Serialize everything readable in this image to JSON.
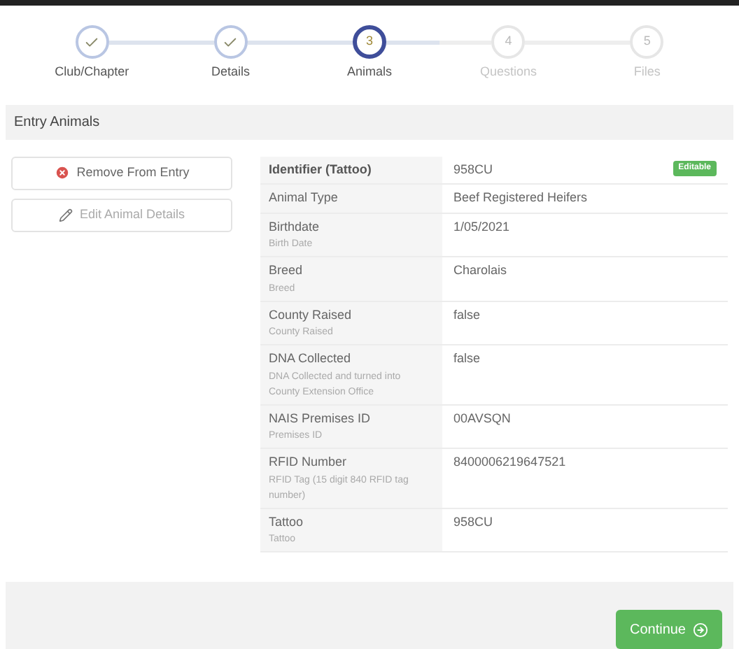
{
  "steps": [
    {
      "label": "Club/Chapter",
      "kind": "done"
    },
    {
      "label": "Details",
      "kind": "done"
    },
    {
      "label": "Animals",
      "kind": "current",
      "number": "3"
    },
    {
      "label": "Questions",
      "kind": "upcoming",
      "number": "4"
    },
    {
      "label": "Files",
      "kind": "upcoming",
      "number": "5"
    }
  ],
  "section_title": "Entry Animals",
  "actions": [
    {
      "label": "Remove From Entry",
      "kind": "remove"
    },
    {
      "label": "Edit Animal Details",
      "kind": "edit"
    }
  ],
  "details": [
    {
      "label": "Identifier (Tattoo)",
      "value": "958CU",
      "badge": "Editable",
      "kind": "key"
    },
    {
      "label": "Animal Type",
      "value": "Beef Registered Heifers",
      "kind": "field"
    },
    {
      "label": "Birthdate",
      "hint": "Birth Date",
      "value": "1/05/2021",
      "kind": "field"
    },
    {
      "label": "Breed",
      "hint": "Breed",
      "value": "Charolais",
      "kind": "field"
    },
    {
      "label": "County Raised",
      "hint": "County Raised",
      "value": "false",
      "kind": "field"
    },
    {
      "label": "DNA Collected",
      "hint": "DNA Collected and turned into County Extension Office",
      "value": "false",
      "kind": "field"
    },
    {
      "label": "NAIS Premises ID",
      "hint": "Premises ID",
      "value": "00AVSQN",
      "kind": "field"
    },
    {
      "label": "RFID Number",
      "hint": "RFID Tag (15 digit 840 RFID tag number)",
      "value": "8400006219647521",
      "kind": "field"
    },
    {
      "label": "Tattoo",
      "hint": "Tattoo",
      "value": "958CU",
      "kind": "field"
    }
  ],
  "continue_button": "Continue"
}
